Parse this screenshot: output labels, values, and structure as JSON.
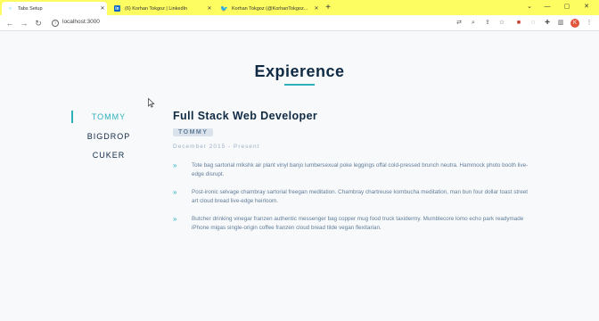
{
  "browser": {
    "tabs": [
      {
        "title": "Tabs Setup",
        "favicon": "react-icon",
        "active": true
      },
      {
        "title": "(6) Korhan Tokgoz | LinkedIn",
        "favicon": "linkedin-icon",
        "active": false
      },
      {
        "title": "Korhan Tokgoz (@KorhanTokgoz...",
        "favicon": "twitter-icon",
        "active": false
      }
    ],
    "url": "localhost:3000",
    "profile_initial": "K"
  },
  "page": {
    "heading": "Expierence",
    "companies": [
      "TOMMY",
      "BIGDROP",
      "CUKER"
    ],
    "active_company": "TOMMY",
    "job": {
      "title": "Full Stack Web Developer",
      "company": "TOMMY",
      "dates": "December 2015 - Present",
      "duties": [
        "Tote bag sartorial mlkshk air plant vinyl banjo lumbersexual poke leggings offal cold-pressed brunch neutra. Hammock photo booth live-edge disrupt.",
        "Post-ironic selvage chambray sartorial freegan meditation. Chambray chartreuse kombucha meditation, man bun four dollar toast street art cloud bread live-edge heirloom.",
        "Butcher drinking vinegar franzen authentic messenger bag copper mug food truck taxidermy. Mumblecore lomo echo park readymade iPhone migas single-origin coffee franzen cloud bread tilde vegan flexitarian."
      ]
    }
  },
  "colors": {
    "accent": "#2cb1bc",
    "heading": "#102a43",
    "body_text": "#617d98",
    "tabstrip": "#fdfd62"
  }
}
